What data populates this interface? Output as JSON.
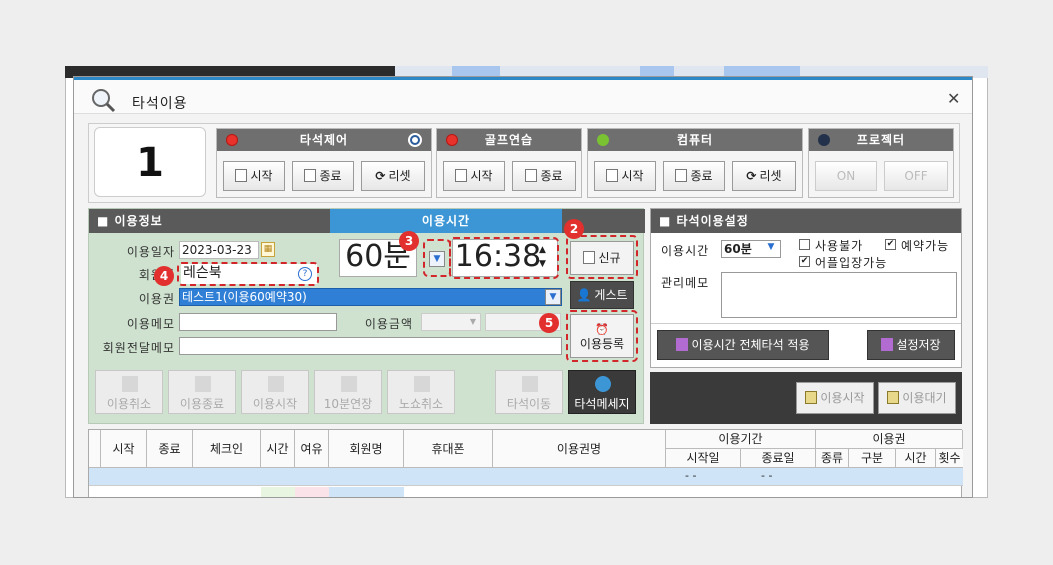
{
  "window": {
    "title": "타석이용",
    "close_label": "✕"
  },
  "seat": {
    "number": "1"
  },
  "groups": {
    "seat_control": {
      "title": "타석제어",
      "start": "시작",
      "end": "종료",
      "reset": "리셋"
    },
    "golf_practice": {
      "title": "골프연습",
      "start": "시작",
      "end": "종료"
    },
    "computer": {
      "title": "컴퓨터",
      "start": "시작",
      "end": "종료",
      "reset": "리셋"
    },
    "projector": {
      "title": "프로젝터",
      "on": "ON",
      "off": "OFF"
    }
  },
  "usage_info": {
    "header": "이용정보",
    "date_label": "이용일자",
    "date_value": "2023-03-23",
    "member_label": "회원명",
    "member_value": "레슨북",
    "pass_label": "이용권",
    "pass_value": "테스트1(이용60예약30)",
    "memo_label": "이용메모",
    "memo_value": "",
    "amount_label": "이용금액",
    "transfer_memo_label": "회원전달메모",
    "transfer_memo_value": ""
  },
  "usage_time": {
    "header": "이용시간",
    "duration": "60분",
    "time": "16:38"
  },
  "side_buttons": {
    "new": "신규",
    "guest": "게스트",
    "register": "이용등록"
  },
  "annotations": {
    "b2": "2",
    "b3": "3",
    "b4": "4",
    "b5": "5"
  },
  "action_buttons": [
    "이용취소",
    "이용종료",
    "이용시작",
    "10분연장",
    "노쇼취소",
    "타석이동",
    "타석메세지"
  ],
  "settings": {
    "header": "타석이용설정",
    "time_label": "이용시간",
    "time_value": "60분",
    "unavailable": "사용불가",
    "unavailable_checked": false,
    "reservable": "예약가능",
    "reservable_checked": true,
    "app_entry": "어플입장가능",
    "app_entry_checked": true,
    "admin_memo_label": "관리메모",
    "apply_all": "이용시간 전체타석 적용",
    "save": "설정저장"
  },
  "dark_bar": {
    "start": "이용시작",
    "wait": "이용대기"
  },
  "table": {
    "columns": [
      "시작",
      "종료",
      "체크인",
      "시간",
      "여유",
      "회원명",
      "휴대폰",
      "이용권명"
    ],
    "period_group": "이용기간",
    "period_cols": [
      "시작일",
      "종료일"
    ],
    "pass_group": "이용권",
    "pass_cols": [
      "종류",
      "구분",
      "시간",
      "횟수"
    ],
    "row1": {
      "start_date": "- -",
      "end_date": "- -"
    }
  },
  "colors": {
    "accent": "#3c96d6",
    "annotation_red": "#d2262a",
    "panel_green": "#cfe2cf"
  }
}
